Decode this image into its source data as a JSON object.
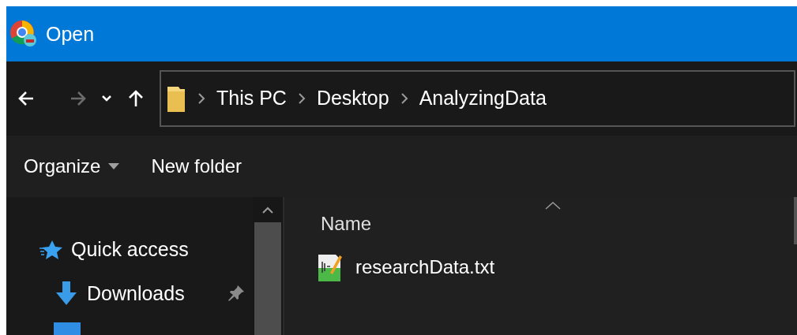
{
  "window": {
    "title": "Open"
  },
  "nav": {
    "back": {
      "disabled": false
    },
    "forward": {
      "disabled": true
    }
  },
  "breadcrumb": [
    "This PC",
    "Desktop",
    "AnalyzingData"
  ],
  "toolbar": {
    "organize": "Organize",
    "new_folder": "New folder"
  },
  "sidebar": {
    "items": [
      {
        "label": "Quick access",
        "kind": "quick",
        "pinned": false
      },
      {
        "label": "Downloads",
        "kind": "downloads",
        "pinned": true
      },
      {
        "kind": "desktop"
      }
    ]
  },
  "file_list": {
    "columns": [
      "Name"
    ],
    "files": [
      {
        "name": "researchData.txt"
      }
    ]
  }
}
